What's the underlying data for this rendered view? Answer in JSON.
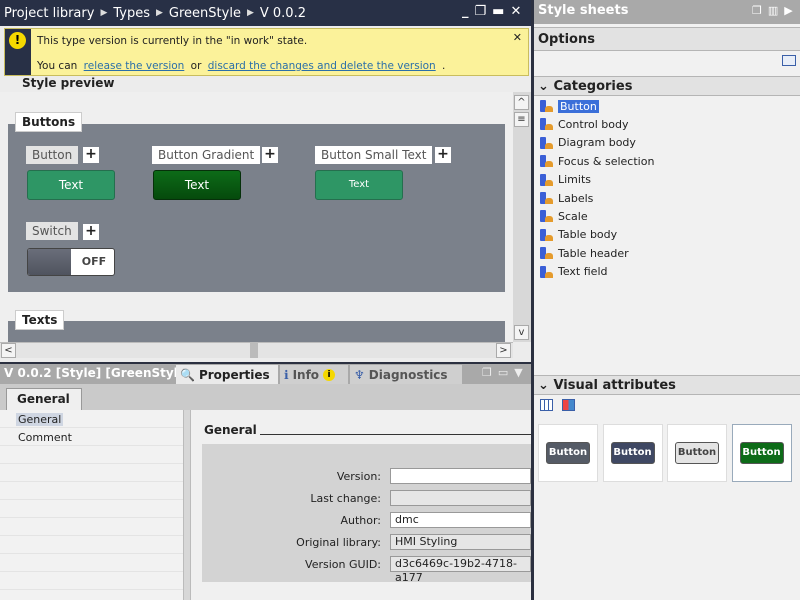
{
  "editor": {
    "breadcrumb": [
      "Project library",
      "Types",
      "GreenStyle",
      "V 0.0.2"
    ],
    "notice": {
      "line1": "This type version is currently in the \"in work\" state.",
      "line2_prefix": "You can",
      "link1": "release the version",
      "or": "or",
      "link2": "discard the changes and delete the version",
      "suffix": "."
    },
    "preview_title": "Style preview",
    "groups": {
      "buttons": {
        "title": "Buttons",
        "items": [
          {
            "label": "Button",
            "text": "Text",
            "color": "#2e9665"
          },
          {
            "label": "Button Gradient",
            "text": "Text",
            "color": "#0d6b18"
          },
          {
            "label": "Button Small Text",
            "text": "Text",
            "color": "#2e9665"
          }
        ],
        "switch": {
          "label": "Switch",
          "state": "OFF"
        }
      },
      "texts": {
        "title": "Texts"
      }
    }
  },
  "properties": {
    "path": "V 0.0.2 [Style] [GreenStyl...",
    "tabs": [
      "Properties",
      "Info",
      "Diagnostics"
    ],
    "subtab": "General",
    "nav": [
      "General",
      "Comment"
    ],
    "section_title": "General",
    "fields": [
      {
        "label": "Version:",
        "value": ""
      },
      {
        "label": "Last change:",
        "value": ""
      },
      {
        "label": "Author:",
        "value": "dmc"
      },
      {
        "label": "Original library:",
        "value": "HMI Styling"
      },
      {
        "label": "Version GUID:",
        "value": "d3c6469c-19b2-4718-a177"
      }
    ]
  },
  "right": {
    "title": "Style sheets",
    "options": "Options",
    "categories_title": "Categories",
    "categories": [
      "Button",
      "Control body",
      "Diagram body",
      "Focus & selection",
      "Limits",
      "Labels",
      "Scale",
      "Table body",
      "Table header",
      "Text field"
    ],
    "visual_title": "Visual attributes",
    "visual_items": [
      {
        "label": "Button",
        "color": "#555b66"
      },
      {
        "label": "Button",
        "color": "#3f4863"
      },
      {
        "label": "Button",
        "color": "#e4e4e4"
      },
      {
        "label": "Button",
        "color": "#0d6b18"
      }
    ]
  }
}
